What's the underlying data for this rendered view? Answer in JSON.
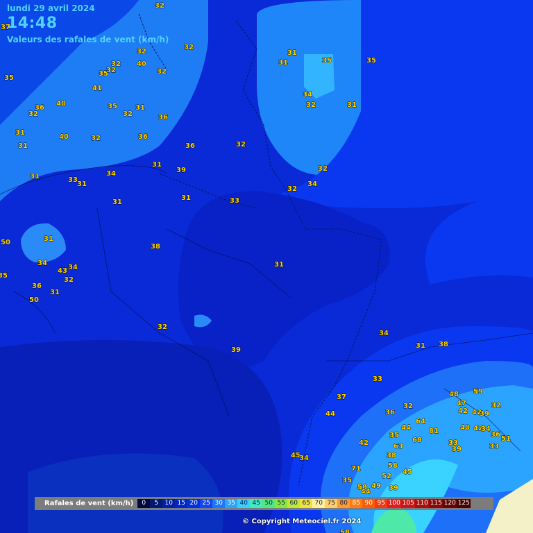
{
  "header": {
    "date": "lundi 29 avril 2024",
    "time": "14:48",
    "subtitle": "Valeurs des rafales de vent (km/h)"
  },
  "legend": {
    "title": "Rafales de vent (km/h)",
    "steps": [
      {
        "label": "0",
        "color": "#000a40",
        "text": "#ffffff"
      },
      {
        "label": "5",
        "color": "#001a70",
        "text": "#ffffff"
      },
      {
        "label": "10",
        "color": "#0020a8",
        "text": "#ffffff"
      },
      {
        "label": "15",
        "color": "#0026c8",
        "text": "#ffffff"
      },
      {
        "label": "20",
        "color": "#0030e0",
        "text": "#ffffff"
      },
      {
        "label": "25",
        "color": "#1246f5",
        "text": "#ffffff"
      },
      {
        "label": "30",
        "color": "#1e78ff",
        "text": "#ffffff"
      },
      {
        "label": "35",
        "color": "#2aa4ff",
        "text": "#ffffff"
      },
      {
        "label": "40",
        "color": "#38d0ff",
        "text": "#00205a"
      },
      {
        "label": "45",
        "color": "#46e8c0",
        "text": "#00205a"
      },
      {
        "label": "50",
        "color": "#50e878",
        "text": "#00205a"
      },
      {
        "label": "55",
        "color": "#88e83a",
        "text": "#00205a"
      },
      {
        "label": "60",
        "color": "#c0e830",
        "text": "#00205a"
      },
      {
        "label": "65",
        "color": "#f0e040",
        "text": "#00205a"
      },
      {
        "label": "70",
        "color": "#fff0a0",
        "text": "#00205a"
      },
      {
        "label": "75",
        "color": "#ffcc66",
        "text": "#00205a"
      },
      {
        "label": "80",
        "color": "#ff9a30",
        "text": "#00205a"
      },
      {
        "label": "85",
        "color": "#ff7a10",
        "text": "#ffffff"
      },
      {
        "label": "90",
        "color": "#ff5a00",
        "text": "#ffffff"
      },
      {
        "label": "95",
        "color": "#f03a10",
        "text": "#ffffff"
      },
      {
        "label": "100",
        "color": "#e02020",
        "text": "#ffffff"
      },
      {
        "label": "105",
        "color": "#c81818",
        "text": "#ffffff"
      },
      {
        "label": "110",
        "color": "#a81010",
        "text": "#ffffff"
      },
      {
        "label": "115",
        "color": "#880808",
        "text": "#ffffff"
      },
      {
        "label": "120",
        "color": "#680404",
        "text": "#ffffff"
      },
      {
        "label": "125",
        "color": "#480000",
        "text": "#ffffff"
      }
    ]
  },
  "copyright": "© Copyright Meteociel.fr 2024",
  "stations": [
    "32",
    "37",
    "35",
    "32",
    "32",
    "32",
    "40",
    "35",
    "32",
    "32",
    "41",
    "36",
    "40",
    "35",
    "32",
    "31",
    "32",
    "36",
    "31",
    "40",
    "32",
    "36",
    "31",
    "36",
    "32",
    "31",
    "34",
    "31",
    "39",
    "33",
    "31",
    "31",
    "33",
    "31",
    "50",
    "31",
    "38",
    "34",
    "43",
    "34",
    "35",
    "36",
    "32",
    "31",
    "50",
    "31",
    "32",
    "39",
    "31",
    "31",
    "35",
    "35",
    "34",
    "32",
    "31",
    "32",
    "32",
    "34",
    "34",
    "31",
    "38",
    "33",
    "37",
    "44",
    "36",
    "32",
    "48",
    "59",
    "47",
    "42",
    "39",
    "42",
    "32",
    "64",
    "44",
    "81",
    "35",
    "68",
    "40",
    "42",
    "34",
    "36",
    "51",
    "42",
    "63",
    "33",
    "39",
    "33",
    "38",
    "45",
    "34",
    "71",
    "58",
    "52",
    "45",
    "35",
    "58",
    "49",
    "44",
    "39",
    "58"
  ],
  "colors": {
    "title_accent": "#4fd2ff",
    "value_label": "#ffd400"
  }
}
